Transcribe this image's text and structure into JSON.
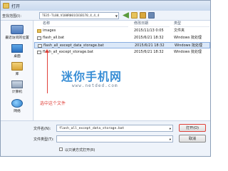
{
  "window": {
    "title": "打开"
  },
  "toolbar": {
    "location_label": "查找范围(I):",
    "location_value": "TE35-TL00_V100R001C01B170_4_4_4"
  },
  "nav": [
    {
      "label": "最近访问的位置",
      "icon": "recent-places-icon"
    },
    {
      "label": "桌面",
      "icon": "desktop-icon"
    },
    {
      "label": "库",
      "icon": "libraries-icon"
    },
    {
      "label": "计算机",
      "icon": "computer-icon"
    },
    {
      "label": "网络",
      "icon": "network-icon"
    }
  ],
  "list": {
    "columns": [
      "名称",
      "修改日期",
      "类型"
    ],
    "rows": [
      {
        "name": "images",
        "date": "2015/11/13 0:05",
        "type": "文件夹",
        "kind": "folder",
        "selected": false
      },
      {
        "name": "flash_all.bat",
        "date": "2015/6/21 18:32",
        "type": "Windows 批处理",
        "kind": "bat",
        "selected": false
      },
      {
        "name": "flash_all_except_data_storage.bat",
        "date": "2015/6/21 18:32",
        "type": "Windows 批处理",
        "kind": "bat",
        "selected": true
      },
      {
        "name": "flash_all_except_storage.bat",
        "date": "2015/6/21 18:32",
        "type": "Windows 批处理",
        "kind": "bat",
        "selected": false
      }
    ]
  },
  "watermark": {
    "text": "迷你手机网",
    "url": "www.netded.com"
  },
  "annotation": {
    "text": "选中这个文件",
    "color": "#e0413a"
  },
  "bottom": {
    "filename_label": "文件名(N):",
    "filename_value": "flash_all_except_data_storage.bat",
    "filetype_label": "文件类型(T):",
    "filetype_value": "",
    "readonly_label": "以只读方式打开(R)",
    "open_label": "打开(O)",
    "cancel_label": "取消"
  }
}
